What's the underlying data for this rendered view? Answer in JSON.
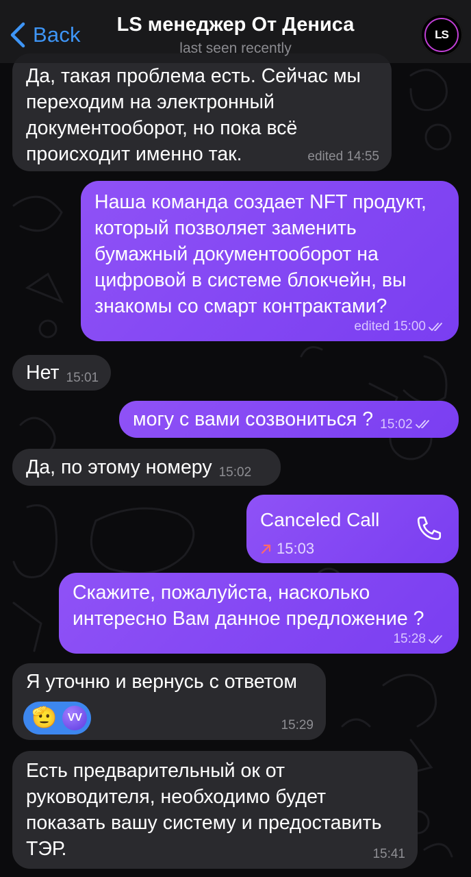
{
  "header": {
    "back_label": "Back",
    "title": "LS менеджер От Дениса",
    "subtitle": "last seen recently",
    "avatar_text": "LS"
  },
  "messages": [
    {
      "direction": "in",
      "text": "Да, такая проблема есть. Сейчас мы\nпереходим на электронный\nдокументооборот, но пока всё\nпроисходит именно так.",
      "time": "edited 14:55"
    },
    {
      "direction": "out",
      "text": "Наша команда создает NFT продукт,\nкоторый позволяет заменить\nбумажный документооборот на\nцифровой в системе блокчейн, вы\nзнакомы со смарт контрактами?",
      "time": "edited 15:00",
      "read": true
    },
    {
      "direction": "in",
      "text": "Нет",
      "time": "15:01"
    },
    {
      "direction": "out",
      "text": "могу с вами созвониться ?",
      "time": "15:02",
      "read": true
    },
    {
      "direction": "in",
      "text": "Да, по этому номеру",
      "time": "15:02"
    },
    {
      "direction": "out",
      "type": "call",
      "title": "Canceled Call",
      "time": "15:03"
    },
    {
      "direction": "out",
      "text": "Скажите, пожалуйста, насколько\nинтересно Вам данное предложение ?",
      "time": "15:28",
      "read": true
    },
    {
      "direction": "in",
      "text": "Я уточню и вернусь с ответом",
      "time": "15:29",
      "reaction": {
        "emoji": "🫡",
        "avatar_text": "VV"
      }
    },
    {
      "direction": "in",
      "text": "Есть предварительный ок от\nруководителя, необходимо будет\nпоказать вашу систему и предоставить\nТЭР.",
      "time": "15:41"
    }
  ],
  "colors": {
    "accent": "#3e95f6",
    "outgoing_bubble": "#8a4ef5",
    "incoming_bubble": "#2a2a2e",
    "background": "#0b0b0d"
  },
  "icons": [
    "chevron-left-icon",
    "double-check-icon",
    "phone-icon",
    "missed-call-arrow-icon"
  ]
}
